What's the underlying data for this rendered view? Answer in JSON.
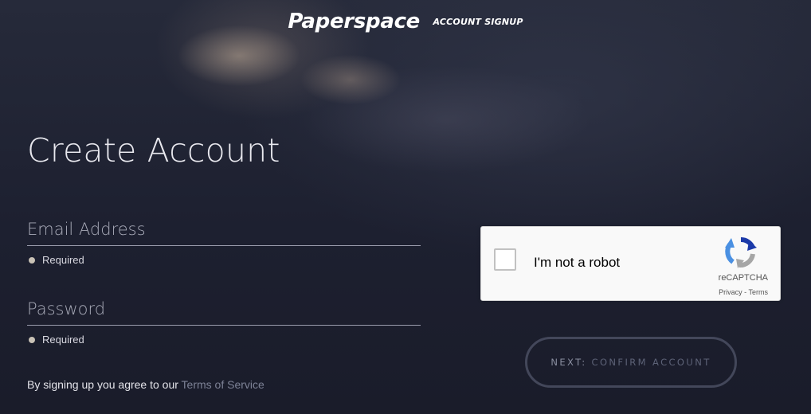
{
  "header": {
    "logo": "Paperspace",
    "subtitle": "ACCOUNT SIGNUP"
  },
  "form": {
    "title": "Create Account",
    "email": {
      "placeholder": "Email Address",
      "value": "",
      "hint": "Required"
    },
    "password": {
      "placeholder": "Password",
      "value": "",
      "hint": "Required"
    },
    "terms_text": "By signing up you agree to our ",
    "terms_link": "Terms of Service"
  },
  "recaptcha": {
    "label": "I'm not a robot",
    "checked": false,
    "brand": "reCAPTCHA",
    "privacy": "Privacy",
    "separator": " - ",
    "terms": "Terms",
    "icon": "recaptcha-logo-icon"
  },
  "next_button": {
    "prefix": "NEXT:",
    "label": "CONFIRM ACCOUNT"
  },
  "colors": {
    "background": "#1e2130",
    "link": "#7d8296",
    "button_border": "#43475a"
  }
}
